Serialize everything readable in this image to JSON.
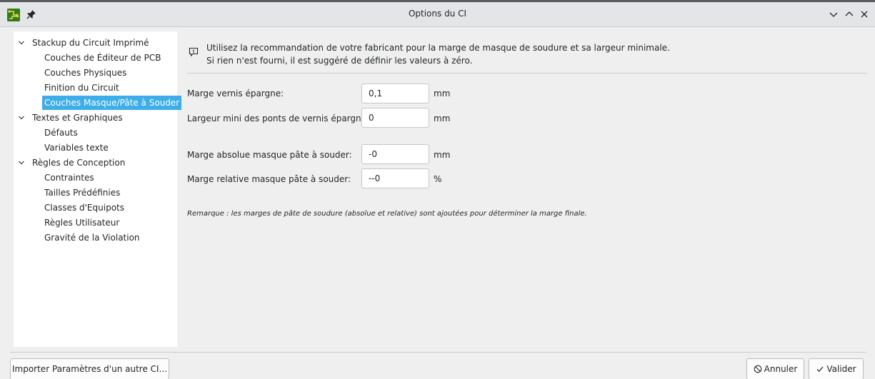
{
  "window": {
    "title": "Options du CI",
    "icons": {
      "app": "kicad-pcb-icon",
      "pin": "pin-icon",
      "minimize": "chevron-down-icon",
      "maximize": "chevron-up-icon",
      "close": "close-icon"
    }
  },
  "sidebar": {
    "groups": [
      {
        "label": "Stackup du Circuit Imprimé",
        "expanded": true,
        "items": [
          "Couches de Éditeur de PCB",
          "Couches Physiques",
          "Finition du Circuit",
          "Couches Masque/Pâte à Souder"
        ]
      },
      {
        "label": "Textes et Graphiques",
        "expanded": true,
        "items": [
          "Défauts",
          "Variables texte"
        ]
      },
      {
        "label": "Règles de Conception",
        "expanded": true,
        "items": [
          "Contraintes",
          "Tailles Prédéfinies",
          "Classes d'Equipots",
          "Règles Utilisateur",
          "Gravité de la Violation"
        ]
      }
    ],
    "selected": "Couches Masque/Pâte à Souder"
  },
  "info": {
    "line1": "Utilisez la recommandation de votre fabricant pour la marge de masque de soudure et sa largeur minimale.",
    "line2": "Si rien n'est fourni, il est suggéré de définir les valeurs à zéro."
  },
  "fields": {
    "solder_mask_clearance": {
      "label": "Marge vernis épargne:",
      "value": "0,1",
      "unit": "mm"
    },
    "solder_mask_min_width": {
      "label": "Largeur mini des ponts de vernis épargne:",
      "value": "0",
      "unit": "mm"
    },
    "paste_abs_clearance": {
      "label": "Marge absolue masque pâte à souder:",
      "value": "-0",
      "unit": "mm"
    },
    "paste_rel_clearance": {
      "label": "Marge relative masque pâte à souder:",
      "value": "--0",
      "unit": "%"
    }
  },
  "remark": "Remarque : les marges de pâte de soudure (absolue et relative) sont ajoutées pour déterminer la marge finale.",
  "buttons": {
    "import": "Importer Paramètres d'un autre CI...",
    "cancel": "Annuler",
    "ok": "Valider"
  },
  "colors": {
    "selection": "#3daee9",
    "app_icon": "#2f7d1f"
  }
}
